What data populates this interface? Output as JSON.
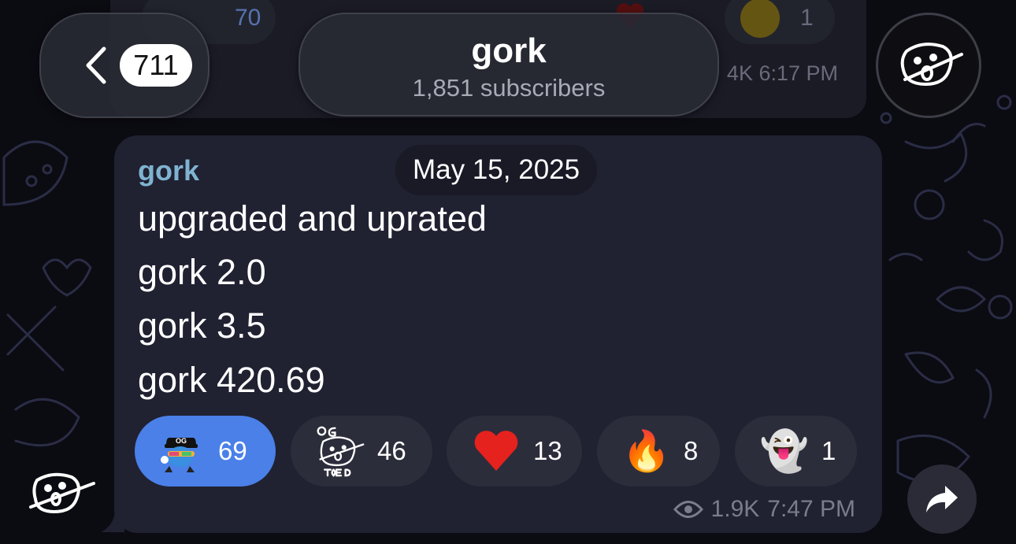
{
  "header": {
    "back_count": "711",
    "title": "gork",
    "subtitle": "1,851 subscribers"
  },
  "previous_message": {
    "reaction_counts": [
      "70",
      "1"
    ],
    "meta": "4K 6:17 PM"
  },
  "message": {
    "sender": "gork",
    "date": "May 15, 2025",
    "lines": [
      "upgraded and uprated",
      "gork 2.0",
      "gork 3.5",
      "gork 420.69"
    ],
    "reactions": [
      {
        "icon": "og-sticker-icon",
        "count": "69",
        "active": true
      },
      {
        "icon": "og-toed-sticker-icon",
        "count": "46",
        "active": false
      },
      {
        "icon": "red-heart-icon",
        "emoji": "❤",
        "count": "13",
        "active": false
      },
      {
        "icon": "fire-icon",
        "emoji": "🔥",
        "count": "8",
        "active": false
      },
      {
        "icon": "ghost-icon",
        "emoji": "👻",
        "count": "1",
        "active": false
      }
    ],
    "views": "1.9K",
    "time": "7:47 PM"
  },
  "colors": {
    "accent": "#4a80e8",
    "sender_name": "#7fb3d0",
    "bubble": "#202131",
    "background": "#0b0b12"
  }
}
